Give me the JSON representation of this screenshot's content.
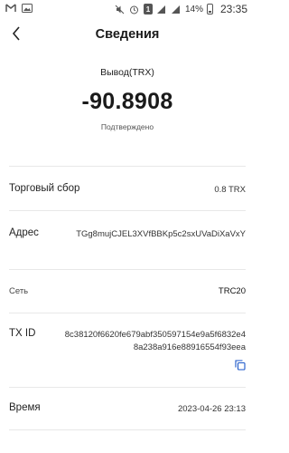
{
  "status_bar": {
    "left_icons": [
      "gmail-icon",
      "picture-icon"
    ],
    "sim_label": "1",
    "battery": "14%",
    "time": "23:35"
  },
  "header": {
    "title": "Сведения"
  },
  "summary": {
    "type": "Вывод(TRX)",
    "amount": "-90.8908",
    "status": "Подтверждено"
  },
  "details": {
    "fee_label": "Торговый сбор",
    "fee_value": "0.8 TRX",
    "address_label": "Адрес",
    "address_value": "TGg8mujCJEL3XVfBBKp5c2sxUVaDiXaVxY",
    "network_label": "Сеть",
    "network_value": "TRC20",
    "txid_label": "TX ID",
    "txid_value": "8c38120f6620fe679abf350597154e9a5f6832e48a238a916e88916554f93eea",
    "time_label": "Время",
    "time_value": "2023-04-26 23:13"
  }
}
